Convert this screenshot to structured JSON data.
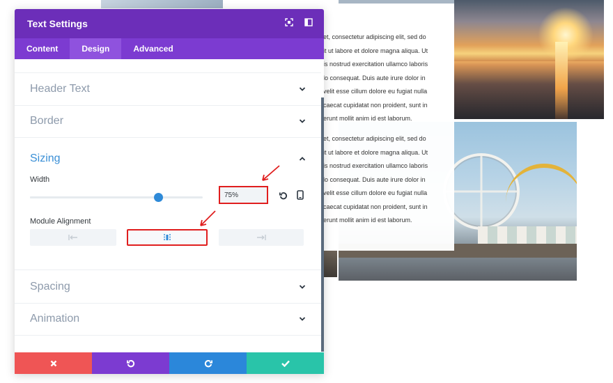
{
  "modal": {
    "title": "Text Settings",
    "tabs": [
      {
        "label": "Content",
        "active": false
      },
      {
        "label": "Design",
        "active": true
      },
      {
        "label": "Advanced",
        "active": false
      }
    ],
    "sections": {
      "header_text": "Header Text",
      "border": "Border",
      "sizing": "Sizing",
      "spacing": "Spacing",
      "animation": "Animation"
    },
    "sizing": {
      "width_label": "Width",
      "width_value": "75%",
      "slider_fraction": 0.74,
      "alignment_label": "Module Alignment"
    },
    "accent": "#6c2eb9"
  },
  "background": {
    "text_block_1": [
      "et, consectetur adipiscing elit, sed do",
      "it ut labore et dolore magna aliqua. Ut",
      "is nostrud exercitation ullamco laboris",
      "lo consequat. Duis aute irure dolor in",
      "velit esse cillum dolore eu fugiat nulla",
      "caecat cupidatat non proident, sunt in",
      "erunt mollit anim id est laborum."
    ],
    "text_block_2": [
      "et, consectetur adipiscing elit, sed do",
      "it ut labore et dolore magna aliqua. Ut",
      "is nostrud exercitation ullamco laboris",
      "lo consequat. Duis aute irure dolor in",
      "velit esse cillum dolore eu fugiat nulla",
      "caecat cupidatat non proident, sunt in",
      "erunt mollit anim id est laborum."
    ]
  },
  "icons": {
    "header": [
      "fullscreen-icon",
      "split-view-icon"
    ],
    "footer": [
      "close-icon",
      "undo-icon",
      "redo-icon",
      "check-icon"
    ]
  }
}
